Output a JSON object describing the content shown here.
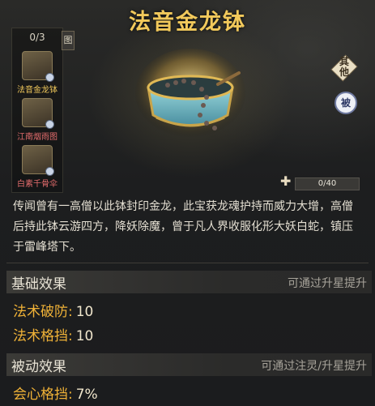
{
  "title": "法音金龙钵",
  "collection": {
    "count": "0/3",
    "items": [
      {
        "label": "法音金龙钵",
        "state": "selected"
      },
      {
        "label": "江南烟雨图",
        "state": "locked"
      },
      {
        "label": "白素千骨伞",
        "state": "locked"
      }
    ],
    "tab_label": "图"
  },
  "badges": {
    "qi": "其他",
    "bei": "被"
  },
  "progress": {
    "text": "0/40",
    "fraction": 0.0
  },
  "description": "传闻曾有一高僧以此钵封印金龙，此宝获龙魂护持而威力大增，高僧后持此钵云游四方，降妖除魔，曾于凡人界收服化形大妖白蛇，镇压于雷峰塔下。",
  "basic": {
    "header": "基础效果",
    "note": "可通过升星提升",
    "stats": [
      {
        "name": "法术破防:",
        "value": "10"
      },
      {
        "name": "法术格挡:",
        "value": "10"
      }
    ]
  },
  "passive": {
    "header": "被动效果",
    "note": "可通过注灵/升星提升",
    "stats": [
      {
        "name": "会心格挡:",
        "value": "7%"
      }
    ]
  },
  "colors": {
    "title": "#f2c95b",
    "stat_name": "#f0b237",
    "selected": "#f2c95b",
    "locked": "#e46d6d"
  }
}
